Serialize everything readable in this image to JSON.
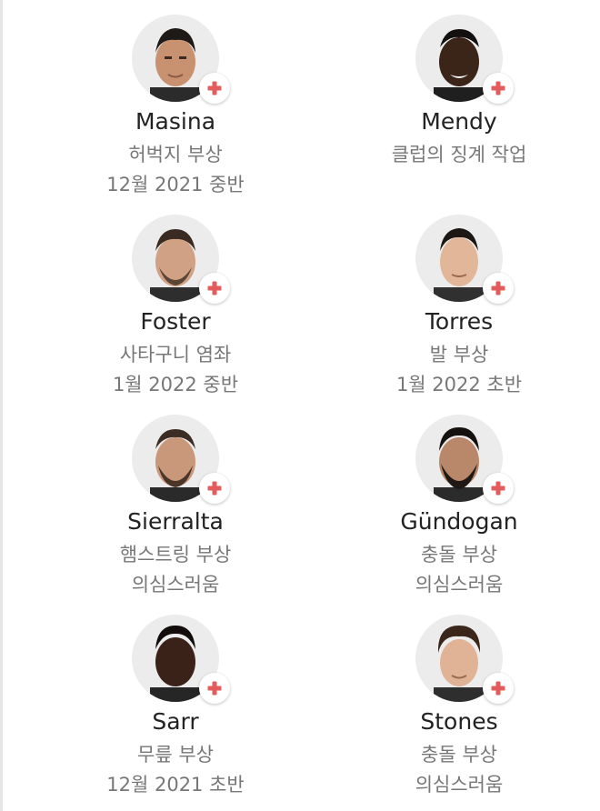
{
  "colors": {
    "badge_cross": "#e35b5b",
    "name_text": "#222222",
    "detail_text": "#777777",
    "avatar_bg": "#ececec"
  },
  "players": [
    {
      "name": "Masina",
      "injury": "허벅지 부상",
      "return": "12월 2021 중반",
      "badge_icon": "red-cross-icon"
    },
    {
      "name": "Mendy",
      "injury": "클럽의 징계 작업",
      "return": "",
      "badge_icon": "red-cross-icon"
    },
    {
      "name": "Foster",
      "injury": "사타구니 염좌",
      "return": "1월 2022 중반",
      "badge_icon": "red-cross-icon"
    },
    {
      "name": "Torres",
      "injury": "발 부상",
      "return": "1월 2022 초반",
      "badge_icon": "red-cross-icon"
    },
    {
      "name": "Sierralta",
      "injury": "햄스트링 부상",
      "return": "의심스러움",
      "badge_icon": "red-cross-icon"
    },
    {
      "name": "Gündogan",
      "injury": "충돌 부상",
      "return": "의심스러움",
      "badge_icon": "red-cross-icon"
    },
    {
      "name": "Sarr",
      "injury": "무릎 부상",
      "return": "12월 2021 초반",
      "badge_icon": "red-cross-icon"
    },
    {
      "name": "Stones",
      "injury": "충돌 부상",
      "return": "의심스러움",
      "badge_icon": "red-cross-icon"
    }
  ]
}
